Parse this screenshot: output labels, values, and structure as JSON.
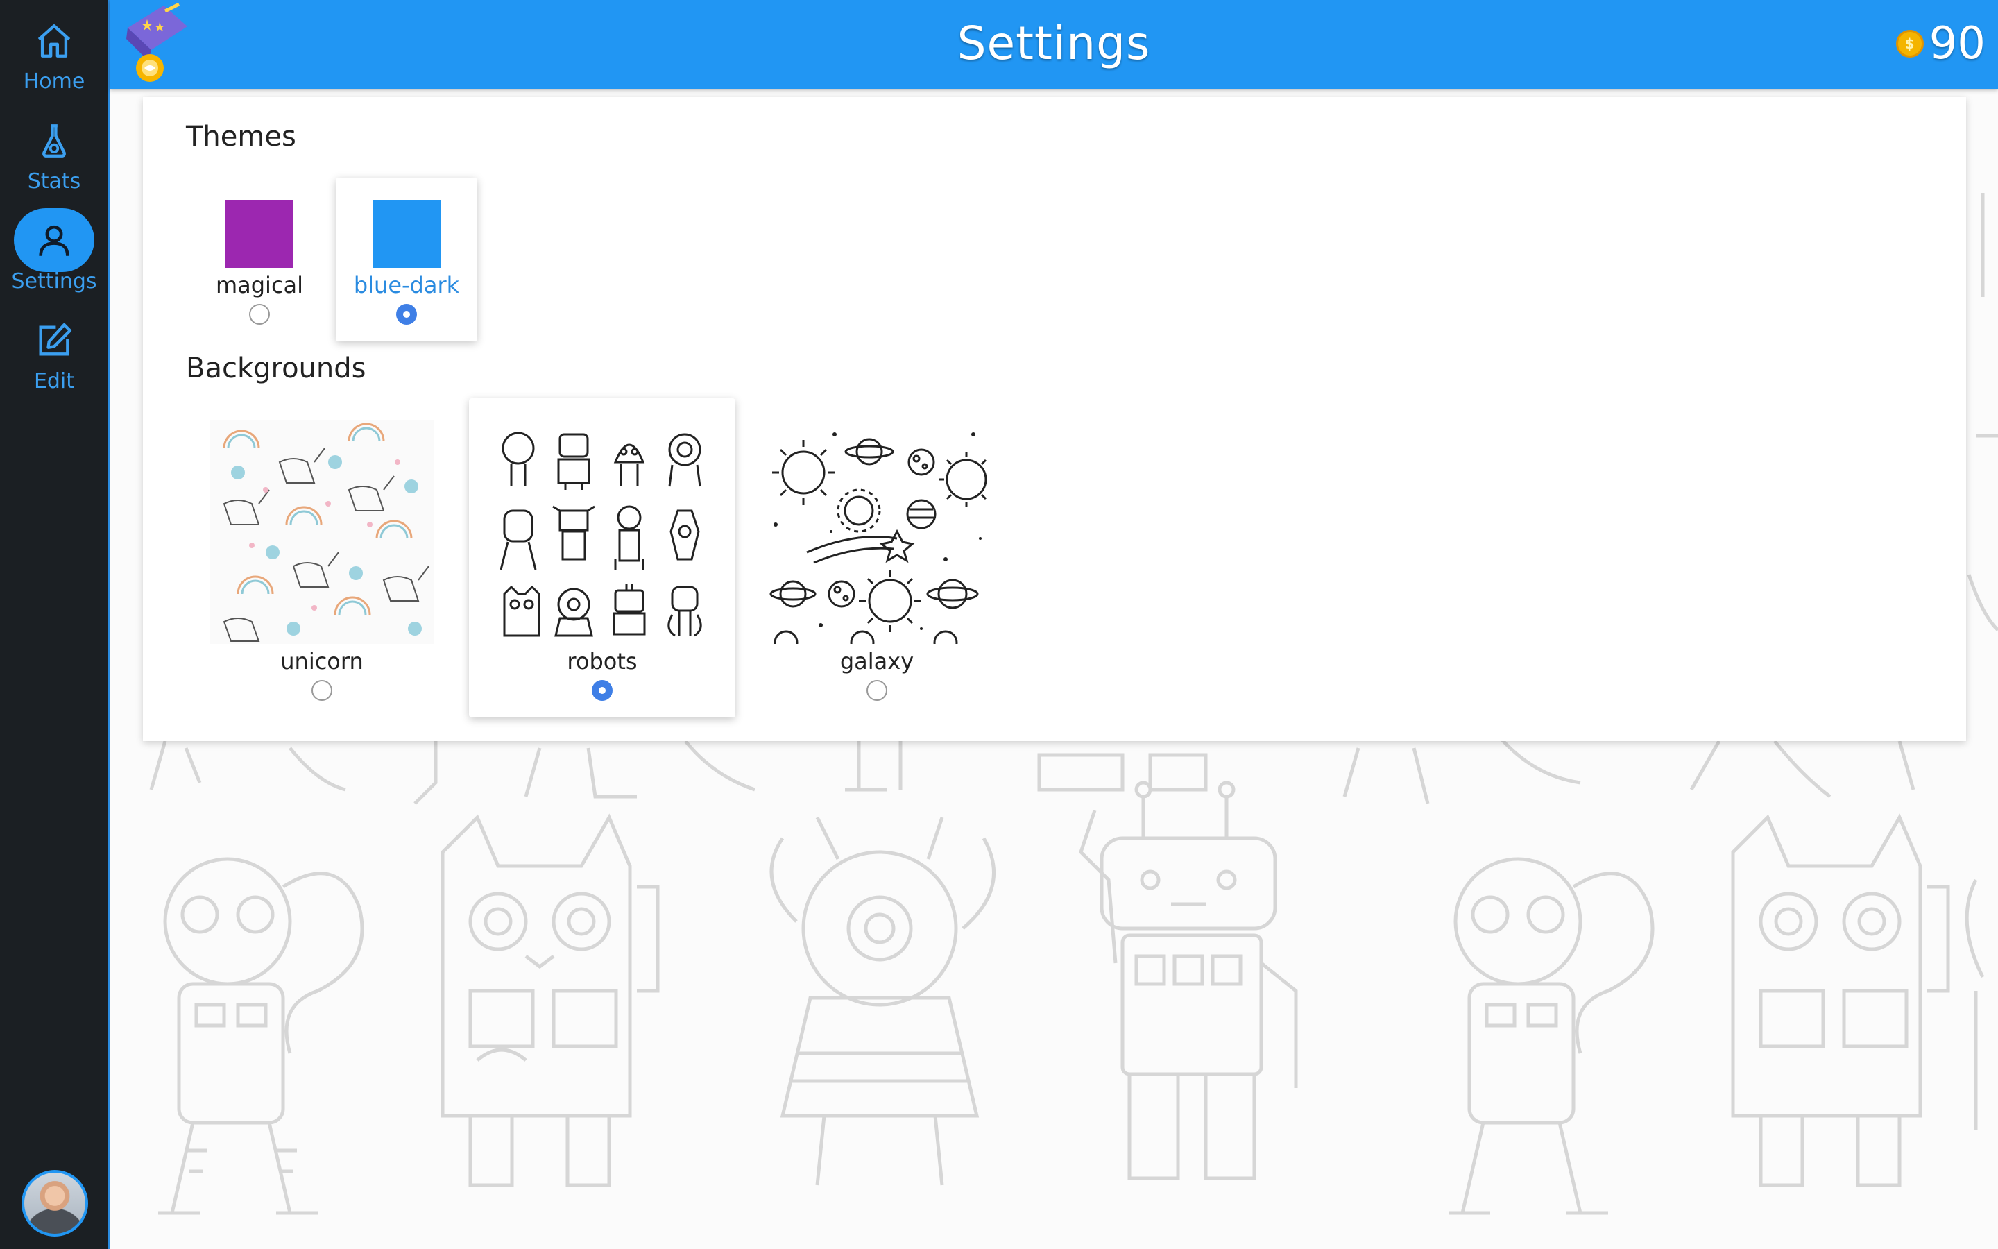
{
  "app": {
    "title": "Settings",
    "coins": "90"
  },
  "sidebar": {
    "items": [
      {
        "label": "Home",
        "icon": "home-icon"
      },
      {
        "label": "Stats",
        "icon": "flask-icon"
      },
      {
        "label": "Settings",
        "icon": "user-icon",
        "active": true
      },
      {
        "label": "Edit",
        "icon": "edit-icon"
      }
    ]
  },
  "themes": {
    "heading": "Themes",
    "options": [
      {
        "label": "magical",
        "color": "#9c27b0",
        "selected": false
      },
      {
        "label": "blue-dark",
        "color": "#2196f3",
        "selected": true
      }
    ]
  },
  "backgrounds": {
    "heading": "Backgrounds",
    "options": [
      {
        "label": "unicorn",
        "selected": false
      },
      {
        "label": "robots",
        "selected": true
      },
      {
        "label": "galaxy",
        "selected": false
      }
    ]
  },
  "colors": {
    "accent": "#2196f3",
    "sidebar": "#1b1f23",
    "sidebar_text": "#3b9ff0",
    "radio_selected": "#3f7fe6"
  }
}
